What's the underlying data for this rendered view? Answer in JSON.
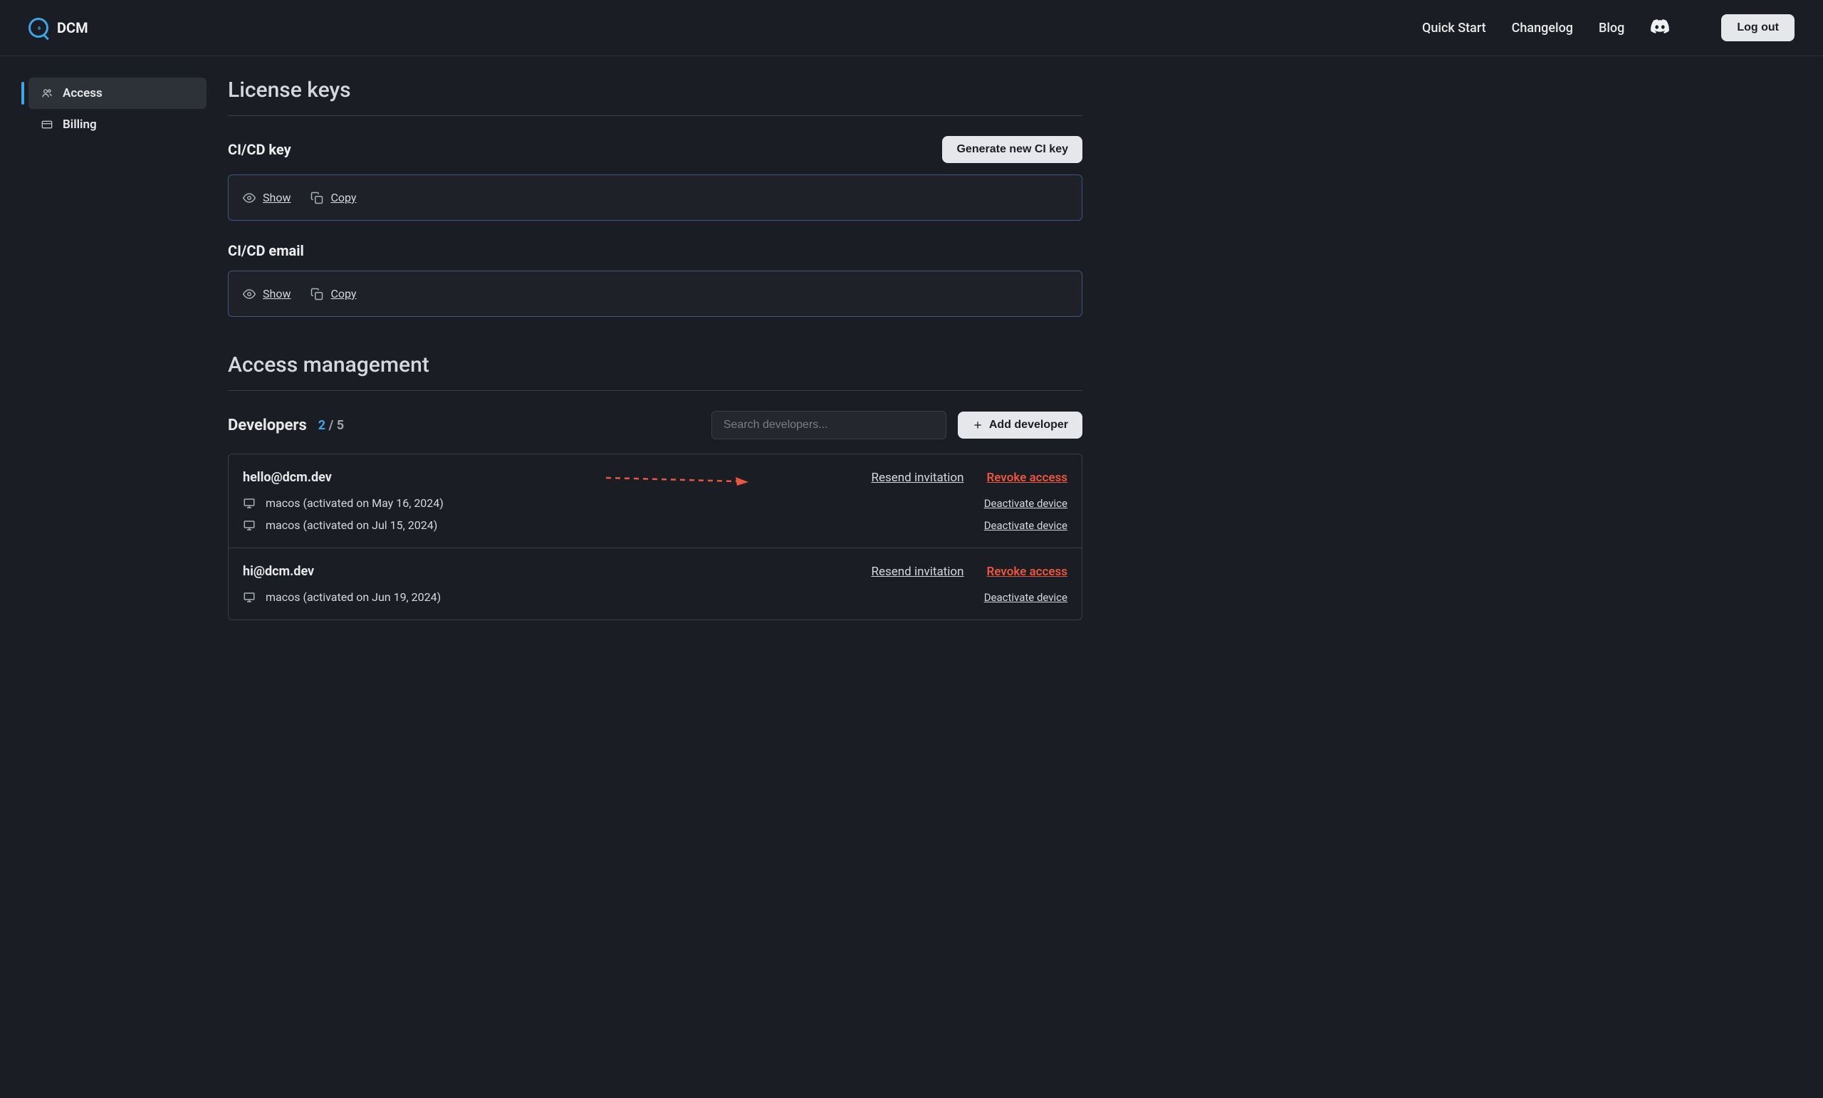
{
  "header": {
    "brand": "DCM",
    "nav": {
      "quickstart": "Quick Start",
      "changelog": "Changelog",
      "blog": "Blog"
    },
    "logout": "Log out"
  },
  "sidebar": {
    "access": "Access",
    "billing": "Billing"
  },
  "license": {
    "title": "License keys",
    "ci_key": {
      "label": "CI/CD key",
      "generate_btn": "Generate new CI key",
      "show": "Show",
      "copy": "Copy"
    },
    "ci_email": {
      "label": "CI/CD email",
      "show": "Show",
      "copy": "Copy"
    }
  },
  "access": {
    "title": "Access management",
    "developers_label": "Developers",
    "count_current": "2",
    "count_sep": " / ",
    "count_max": "5",
    "search_placeholder": "Search developers...",
    "add_btn": "Add developer",
    "resend_label": "Resend invitation",
    "revoke_label": "Revoke access",
    "deactivate_label": "Deactivate device",
    "developers": [
      {
        "email": "hello@dcm.dev",
        "devices": [
          {
            "text": "macos (activated on May 16, 2024)"
          },
          {
            "text": "macos (activated on Jul 15, 2024)"
          }
        ]
      },
      {
        "email": "hi@dcm.dev",
        "devices": [
          {
            "text": "macos (activated on Jun 19, 2024)"
          }
        ]
      }
    ]
  }
}
